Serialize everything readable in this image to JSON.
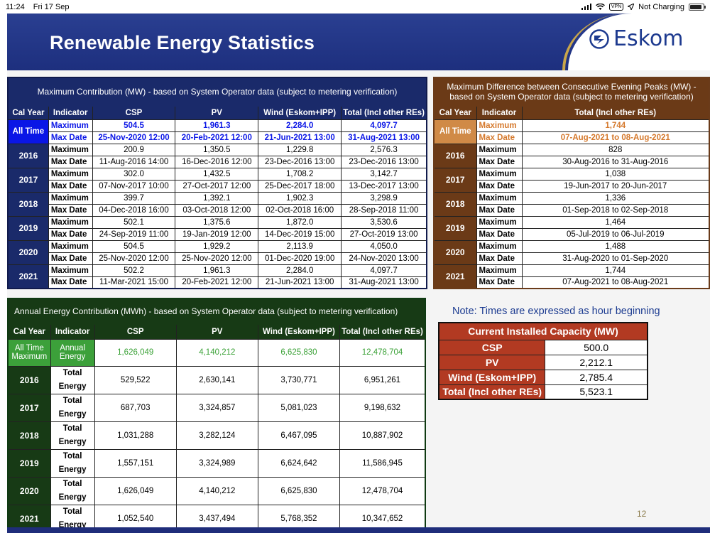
{
  "status_bar": {
    "time": "11:24",
    "date": "Fri 17 Sep",
    "vpn": "VPN",
    "battery_text": "Not Charging"
  },
  "slide": {
    "title": "Renewable Energy Statistics",
    "logo_text": "Eskom",
    "page_number": "12",
    "note": "Note: Times are expressed as hour beginning"
  },
  "colors": {
    "title_bg": "#1d2f7e",
    "table1_bg": "#1a2a6a",
    "table1_accent": "#0a16e6",
    "table2_bg": "#6b3a17",
    "table2_accent": "#d5782b",
    "table3_bg": "#173a15",
    "table3_accent": "#3ca03a",
    "table4_bg": "#b23a22"
  },
  "max_contribution": {
    "caption": "Maximum Contribution (MW) - based on System Operator data (subject to metering verification)",
    "headers": [
      "Cal Year",
      "Indicator",
      "CSP",
      "PV",
      "Wind (Eskom+IPP)",
      "Total (Incl other REs)"
    ],
    "all_time": {
      "label": "All Time",
      "max_label": "Maximum",
      "date_label": "Max Date",
      "max": [
        "504.5",
        "1,961.3",
        "2,284.0",
        "4,097.7"
      ],
      "date": [
        "25-Nov-2020 12:00",
        "20-Feb-2021 12:00",
        "21-Jun-2021 13:00",
        "31-Aug-2021 13:00"
      ]
    },
    "years": [
      {
        "year": "2016",
        "max_label": "Maximum",
        "date_label": "Max Date",
        "max": [
          "200.9",
          "1,350.5",
          "1,229.8",
          "2,576.3"
        ],
        "date": [
          "11-Aug-2016 14:00",
          "16-Dec-2016 12:00",
          "23-Dec-2016 13:00",
          "23-Dec-2016 13:00"
        ]
      },
      {
        "year": "2017",
        "max_label": "Maximum",
        "date_label": "Max Date",
        "max": [
          "302.0",
          "1,432.5",
          "1,708.2",
          "3,142.7"
        ],
        "date": [
          "07-Nov-2017 10:00",
          "27-Oct-2017 12:00",
          "25-Dec-2017 18:00",
          "13-Dec-2017 13:00"
        ]
      },
      {
        "year": "2018",
        "max_label": "Maximum",
        "date_label": "Max Date",
        "max": [
          "399.7",
          "1,392.1",
          "1,902.3",
          "3,298.9"
        ],
        "date": [
          "04-Dec-2018 16:00",
          "03-Oct-2018 12:00",
          "02-Oct-2018 16:00",
          "28-Sep-2018 11:00"
        ]
      },
      {
        "year": "2019",
        "max_label": "Maximum",
        "date_label": "Max Date",
        "max": [
          "502.1",
          "1,375.6",
          "1,872.0",
          "3,530.6"
        ],
        "date": [
          "24-Sep-2019 11:00",
          "19-Jan-2019 12:00",
          "14-Dec-2019 15:00",
          "27-Oct-2019 13:00"
        ]
      },
      {
        "year": "2020",
        "max_label": "Maximum",
        "date_label": "Max Date",
        "max": [
          "504.5",
          "1,929.2",
          "2,113.9",
          "4,050.0"
        ],
        "date": [
          "25-Nov-2020 12:00",
          "25-Nov-2020 12:00",
          "01-Dec-2020 19:00",
          "24-Nov-2020 13:00"
        ]
      },
      {
        "year": "2021",
        "max_label": "Maximum",
        "date_label": "Max Date",
        "max": [
          "502.2",
          "1,961.3",
          "2,284.0",
          "4,097.7"
        ],
        "date": [
          "11-Mar-2021 15:00",
          "20-Feb-2021 12:00",
          "21-Jun-2021 13:00",
          "31-Aug-2021 13:00"
        ]
      }
    ]
  },
  "max_difference": {
    "caption_line1": "Maximum Difference between Consecutive Evening Peaks (MW) -",
    "caption_line2": "based on System Operator data (subject to metering verification)",
    "headers": [
      "Cal Year",
      "Indicator",
      "Total (Incl other REs)"
    ],
    "all_time": {
      "label": "All Time",
      "max_label": "Maximum",
      "date_label": "Max Date",
      "max": "1,744",
      "date": "07-Aug-2021 to 08-Aug-2021"
    },
    "years": [
      {
        "year": "2016",
        "max_label": "Maximum",
        "date_label": "Max Date",
        "max": "828",
        "date": "30-Aug-2016 to 31-Aug-2016"
      },
      {
        "year": "2017",
        "max_label": "Maximum",
        "date_label": "Max Date",
        "max": "1,038",
        "date": "19-Jun-2017 to 20-Jun-2017"
      },
      {
        "year": "2018",
        "max_label": "Maximum",
        "date_label": "Max Date",
        "max": "1,336",
        "date": "01-Sep-2018 to 02-Sep-2018"
      },
      {
        "year": "2019",
        "max_label": "Maximum",
        "date_label": "Max Date",
        "max": "1,464",
        "date": "05-Jul-2019 to 06-Jul-2019"
      },
      {
        "year": "2020",
        "max_label": "Maximum",
        "date_label": "Max Date",
        "max": "1,488",
        "date": "31-Aug-2020 to 01-Sep-2020"
      },
      {
        "year": "2021",
        "max_label": "Maximum",
        "date_label": "Max Date",
        "max": "1,744",
        "date": "07-Aug-2021 to 08-Aug-2021"
      }
    ]
  },
  "annual_energy": {
    "caption": "Annual Energy Contribution (MWh) - based on System Operator data (subject to metering verification)",
    "headers": [
      "Cal Year",
      "Indicator",
      "CSP",
      "PV",
      "Wind (Eskom+IPP)",
      "Total (Incl other REs)"
    ],
    "all_time": {
      "label_line1": "All Time",
      "label_line2": "Maximum",
      "indicator_line1": "Annual",
      "indicator_line2": "Energy",
      "values": [
        "1,626,049",
        "4,140,212",
        "6,625,830",
        "12,478,704"
      ]
    },
    "years": [
      {
        "year": "2016",
        "ind1": "Total",
        "ind2": "Energy",
        "values": [
          "529,522",
          "2,630,141",
          "3,730,771",
          "6,951,261"
        ]
      },
      {
        "year": "2017",
        "ind1": "Total",
        "ind2": "Energy",
        "values": [
          "687,703",
          "3,324,857",
          "5,081,023",
          "9,198,632"
        ]
      },
      {
        "year": "2018",
        "ind1": "Total",
        "ind2": "Energy",
        "values": [
          "1,031,288",
          "3,282,124",
          "6,467,095",
          "10,887,902"
        ]
      },
      {
        "year": "2019",
        "ind1": "Total",
        "ind2": "Energy",
        "values": [
          "1,557,151",
          "3,324,989",
          "6,624,642",
          "11,586,945"
        ]
      },
      {
        "year": "2020",
        "ind1": "Total",
        "ind2": "Energy",
        "values": [
          "1,626,049",
          "4,140,212",
          "6,625,830",
          "12,478,704"
        ]
      },
      {
        "year": "2021",
        "ind1": "Total",
        "ind2": "Energy",
        "values": [
          "1,052,540",
          "3,437,494",
          "5,768,352",
          "10,347,652"
        ]
      }
    ]
  },
  "installed_capacity": {
    "caption": "Current Installed Capacity (MW)",
    "rows": [
      {
        "label": "CSP",
        "value": "500.0"
      },
      {
        "label": "PV",
        "value": "2,212.1"
      },
      {
        "label": "Wind (Eskom+IPP)",
        "value": "2,785.4"
      },
      {
        "label": "Total (Incl other REs)",
        "value": "5,523.1"
      }
    ]
  }
}
